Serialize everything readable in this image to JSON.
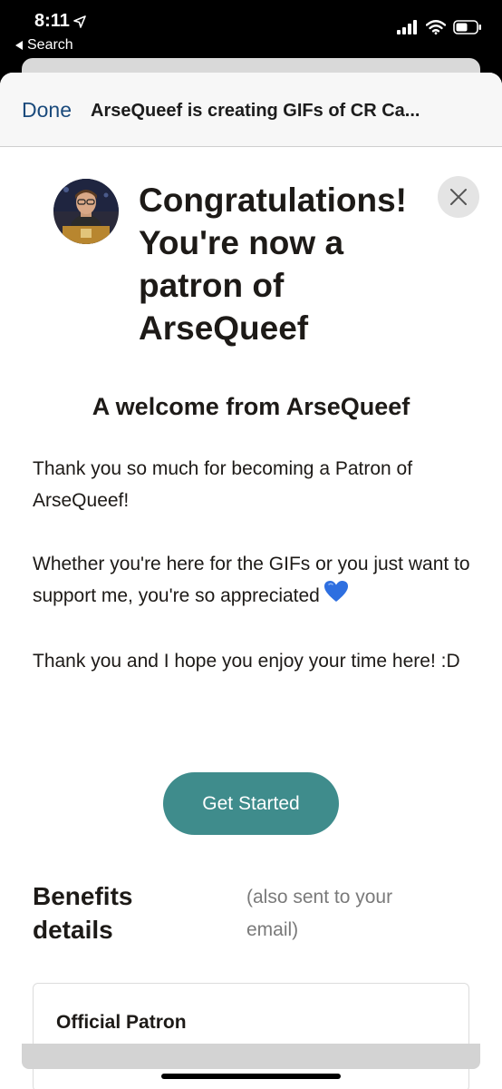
{
  "status_bar": {
    "time": "8:11",
    "back_app": "Search",
    "location_icon": "location-arrow-icon",
    "signal_icon": "cellular-signal-icon",
    "wifi_icon": "wifi-icon",
    "battery_icon": "battery-icon"
  },
  "nav": {
    "done_label": "Done",
    "title": "ArseQueef is creating GIFs of CR Ca..."
  },
  "header": {
    "avatar": "creator-avatar",
    "congrats_title": "Congratulations! You're now a patron of ArseQueef",
    "close_icon": "close-icon"
  },
  "welcome": {
    "heading": "A welcome from ArseQueef",
    "paragraph_1": "Thank you so much for becoming a Patron of ArseQueef!",
    "paragraph_2": "Whether you're here for the GIFs or you just want to support me, you're so appreciated",
    "paragraph_2_emoji": "blue-heart-icon",
    "paragraph_3": "Thank you and I hope you enjoy your time here! :D"
  },
  "actions": {
    "get_started_label": "Get Started"
  },
  "benefits": {
    "heading": "Benefits details",
    "note": "(also sent to your email)",
    "tier_name": "Official Patron"
  },
  "colors": {
    "accent_teal": "#3f8c8c",
    "done_blue": "#1a4a7c",
    "text_dark": "#1d1a17",
    "heart_blue": "#2e6fe0"
  }
}
